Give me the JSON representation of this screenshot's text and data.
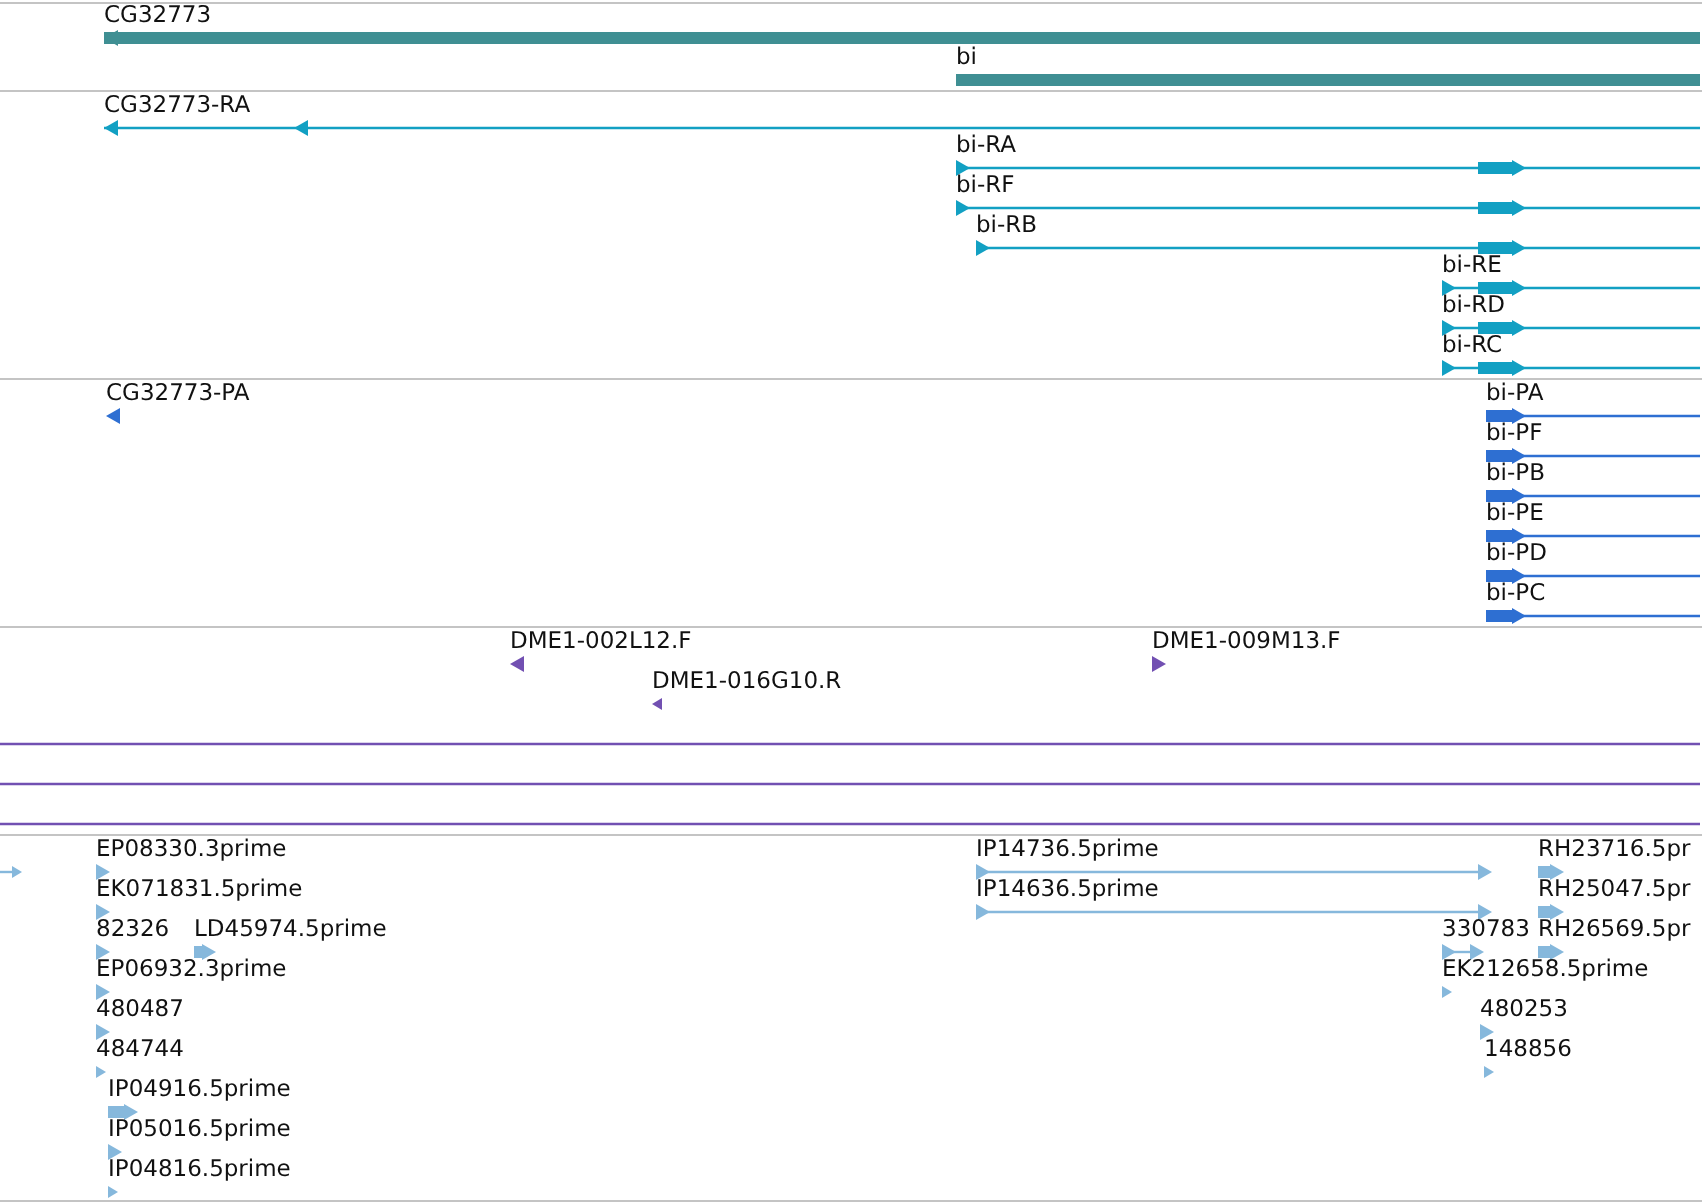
{
  "tracks": [
    {
      "kind": "gene",
      "color": "#3f8f93",
      "features": [
        {
          "label": "CG32773",
          "reverse": true
        },
        {
          "label": "bi"
        }
      ]
    },
    {
      "kind": "transcript",
      "color": "#12a0c3",
      "features": [
        {
          "label": "CG32773-RA",
          "reverse": true
        },
        {
          "label": "bi-RA",
          "reverse": false
        },
        {
          "label": "bi-RF",
          "reverse": false
        },
        {
          "label": "bi-RB",
          "reverse": false
        },
        {
          "label": "bi-RE",
          "reverse": false
        },
        {
          "label": "bi-RD",
          "reverse": false
        },
        {
          "label": "bi-RC",
          "reverse": false
        }
      ]
    },
    {
      "kind": "protein",
      "color": "#2e6fd2",
      "features": [
        {
          "label": "CG32773-PA",
          "reverse": true
        },
        {
          "label": "bi-PA",
          "reverse": false
        },
        {
          "label": "bi-PF",
          "reverse": false
        },
        {
          "label": "bi-PB",
          "reverse": false
        },
        {
          "label": "bi-PE",
          "reverse": false
        },
        {
          "label": "bi-PD",
          "reverse": false
        },
        {
          "label": "bi-PC",
          "reverse": false
        }
      ]
    },
    {
      "kind": "oligo",
      "color": "#7250b2",
      "features": [
        {
          "kind": "probe",
          "label": "DME1-002L12.F",
          "reverse": true
        },
        {
          "kind": "probe",
          "label": "DME1-016G10.R",
          "reverse": true
        },
        {
          "kind": "probe",
          "label": "DME1-009M13.F",
          "reverse": false
        },
        {
          "kind": "line"
        },
        {
          "kind": "line"
        },
        {
          "kind": "line"
        }
      ]
    },
    {
      "kind": "est",
      "color": "#86b8dc",
      "features": [
        {
          "reverse": false
        },
        {
          "label": "EP08330.3prime",
          "reverse": false
        },
        {
          "label": "IP14736.5prime",
          "reverse": false
        },
        {
          "label": "RH23716.5pr",
          "reverse": false
        },
        {
          "label": "EK071831.5prime",
          "reverse": false
        },
        {
          "label": "IP14636.5prime",
          "reverse": false
        },
        {
          "label": "RH25047.5pr",
          "reverse": false
        },
        {
          "label": "82326",
          "reverse": false
        },
        {
          "label": "LD45974.5prime",
          "reverse": false
        },
        {
          "label": "330783",
          "reverse": false
        },
        {
          "label": "RH26569.5pr",
          "reverse": false
        },
        {
          "label": "EP06932.3prime",
          "reverse": false
        },
        {
          "label": "EK212658.5prime",
          "reverse": false
        },
        {
          "label": "480487",
          "reverse": false
        },
        {
          "label": "480253",
          "reverse": false
        },
        {
          "label": "484744",
          "reverse": false
        },
        {
          "label": "148856",
          "reverse": false
        },
        {
          "label": "IP04916.5prime",
          "reverse": false
        },
        {
          "label": "IP05016.5prime",
          "reverse": false
        },
        {
          "label": "IP04816.5prime",
          "reverse": false
        }
      ]
    }
  ]
}
